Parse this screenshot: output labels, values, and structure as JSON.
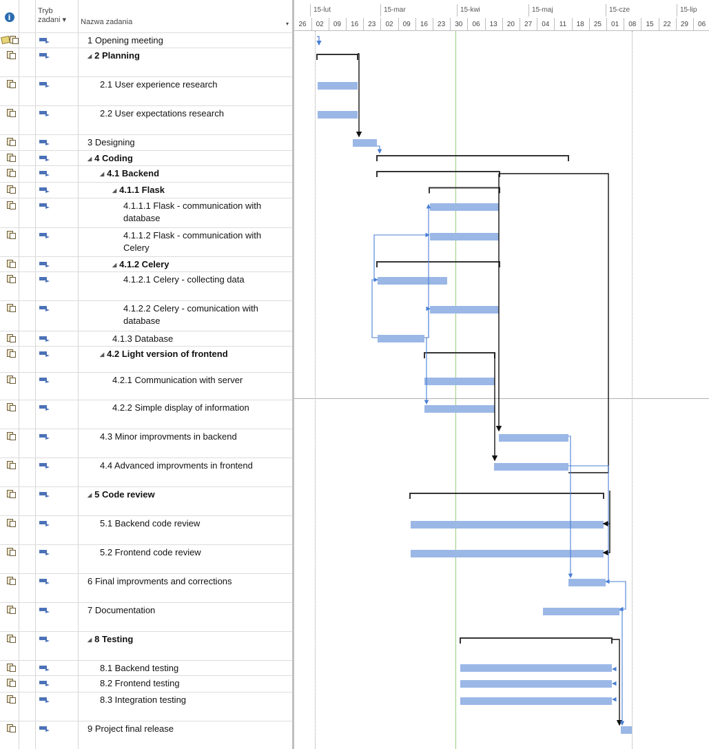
{
  "header": {
    "info_symbol": "i",
    "mode_label_line1": "Tryb",
    "mode_label_line2": "zadani ▾",
    "name_label": "Nazwa zadania",
    "name_dropdown": "▾"
  },
  "timeline": {
    "months": [
      "15-lut",
      "15-mar",
      "15-kwi",
      "15-maj",
      "15-cze",
      "15-lip"
    ],
    "days": [
      "26",
      "02",
      "09",
      "16",
      "23",
      "02",
      "09",
      "16",
      "23",
      "30",
      "06",
      "13",
      "20",
      "27",
      "04",
      "11",
      "18",
      "25",
      "01",
      "08",
      "15",
      "22",
      "29",
      "06"
    ]
  },
  "tasks": [
    {
      "name": "1 Opening meeting",
      "bold": false,
      "indent": 0,
      "collapse": false
    },
    {
      "name": "2 Planning",
      "bold": true,
      "indent": 0,
      "collapse": true
    },
    {
      "name": "2.1 User experience research",
      "bold": false,
      "indent": 1,
      "collapse": false
    },
    {
      "name": "2.2 User expectations research",
      "bold": false,
      "indent": 1,
      "collapse": false
    },
    {
      "name": "3 Designing",
      "bold": false,
      "indent": 0,
      "collapse": false
    },
    {
      "name": "4 Coding",
      "bold": true,
      "indent": 0,
      "collapse": true
    },
    {
      "name": "4.1 Backend",
      "bold": true,
      "indent": 1,
      "collapse": true
    },
    {
      "name": "4.1.1 Flask",
      "bold": true,
      "indent": 2,
      "collapse": true
    },
    {
      "name": "4.1.1.1 Flask - communication with database",
      "bold": false,
      "indent": 3,
      "collapse": false
    },
    {
      "name": "4.1.1.2 Flask - communication with Celery",
      "bold": false,
      "indent": 3,
      "collapse": false
    },
    {
      "name": "4.1.2 Celery",
      "bold": true,
      "indent": 2,
      "collapse": true
    },
    {
      "name": "4.1.2.1 Celery - collecting data",
      "bold": false,
      "indent": 3,
      "collapse": false
    },
    {
      "name": "4.1.2.2 Celery - comunication with database",
      "bold": false,
      "indent": 3,
      "collapse": false
    },
    {
      "name": "4.1.3 Database",
      "bold": false,
      "indent": 2,
      "collapse": false
    },
    {
      "name": "4.2 Light version of frontend",
      "bold": true,
      "indent": 1,
      "collapse": true
    },
    {
      "name": "4.2.1 Communication with server",
      "bold": false,
      "indent": 2,
      "collapse": false
    },
    {
      "name": "4.2.2 Simple display of information",
      "bold": false,
      "indent": 2,
      "collapse": false
    },
    {
      "name": "4.3 Minor improvments in backend",
      "bold": false,
      "indent": 1,
      "collapse": false
    },
    {
      "name": "4.4 Advanced improvments in frontend",
      "bold": false,
      "indent": 1,
      "collapse": false
    },
    {
      "name": "5 Code review",
      "bold": true,
      "indent": 0,
      "collapse": true
    },
    {
      "name": "5.1 Backend code review",
      "bold": false,
      "indent": 1,
      "collapse": false
    },
    {
      "name": "5.2 Frontend code review",
      "bold": false,
      "indent": 1,
      "collapse": false
    },
    {
      "name": "6 Final improvments and corrections",
      "bold": false,
      "indent": 0,
      "collapse": false
    },
    {
      "name": "7 Documentation",
      "bold": false,
      "indent": 0,
      "collapse": false
    },
    {
      "name": "8 Testing",
      "bold": true,
      "indent": 0,
      "collapse": true
    },
    {
      "name": "8.1 Backend testing",
      "bold": false,
      "indent": 1,
      "collapse": false
    },
    {
      "name": "8.2 Frontend testing",
      "bold": false,
      "indent": 1,
      "collapse": false
    },
    {
      "name": "8.3 Integration testing",
      "bold": false,
      "indent": 1,
      "collapse": false
    },
    {
      "name": "9 Project final release",
      "bold": false,
      "indent": 0,
      "collapse": false
    }
  ],
  "colors": {
    "task_bar": "#9ab7e6",
    "summary_bar": "#333333",
    "link": "#4a7fd4",
    "today_line": "#9acd7a",
    "mode_icon": "#4c72b8"
  },
  "icons": {
    "info": "info-circle-icon",
    "task_mode": "auto-scheduled-task-icon",
    "row_indicator": "task-note-icon"
  }
}
